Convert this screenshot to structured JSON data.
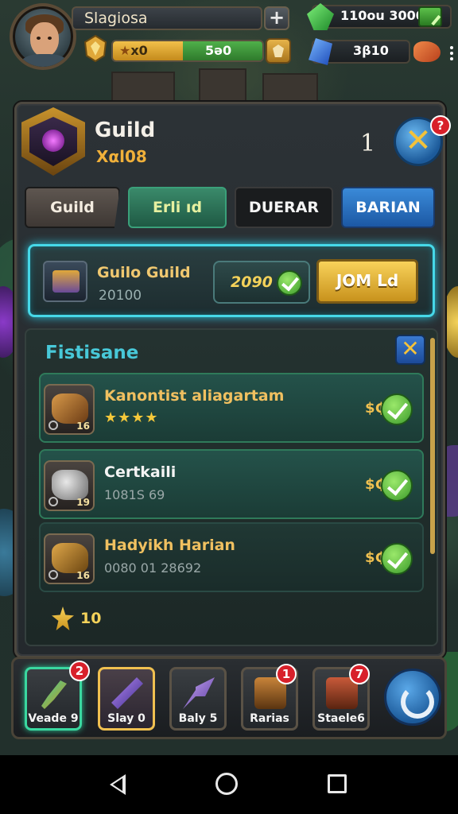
{
  "player": {
    "name": "Slagiosa",
    "plus_label": "+",
    "xp_left": "x0",
    "xp_right": "5ə0",
    "xp_fill_fraction": 0.72
  },
  "resources": {
    "gems_value": "110ou 3000ß",
    "crystals_value": "3β10"
  },
  "panel": {
    "title": "Guild",
    "subtitle": "Xαl08",
    "count": "1",
    "close_badge": "?"
  },
  "tabs": [
    {
      "label": "Guild"
    },
    {
      "label": "Erli ıd"
    },
    {
      "label": "DUERAR"
    },
    {
      "label": "BARIAN"
    }
  ],
  "guild_card": {
    "name": "Guilo Guild",
    "number": "20100",
    "price": "2090",
    "join_label": "JOM Ld"
  },
  "list": {
    "title": "Fistisane",
    "close_label": "✕",
    "rows": [
      {
        "name": "Kanontist aliagartam",
        "stars": "★★★★",
        "level": "16",
        "coin": "$₵"
      },
      {
        "name": "Certkaili",
        "sub": "1081S 69",
        "level": "19",
        "coin": "$₵"
      },
      {
        "name": "Hadyikh Harian",
        "sub": "0080 01 28692",
        "level": "16",
        "coin": "$₵"
      }
    ],
    "count": "10"
  },
  "dock": {
    "items": [
      {
        "label": "Veade 9",
        "badge": "2"
      },
      {
        "label": "Slay 0"
      },
      {
        "label": "Baly 5"
      },
      {
        "label": "Rarias",
        "badge": "1"
      },
      {
        "label": "Staele6",
        "badge": "7"
      }
    ]
  },
  "colors": {
    "accent_cyan": "#46d8e8",
    "gold": "#f0c060",
    "panel_bg": "#2c3236"
  }
}
